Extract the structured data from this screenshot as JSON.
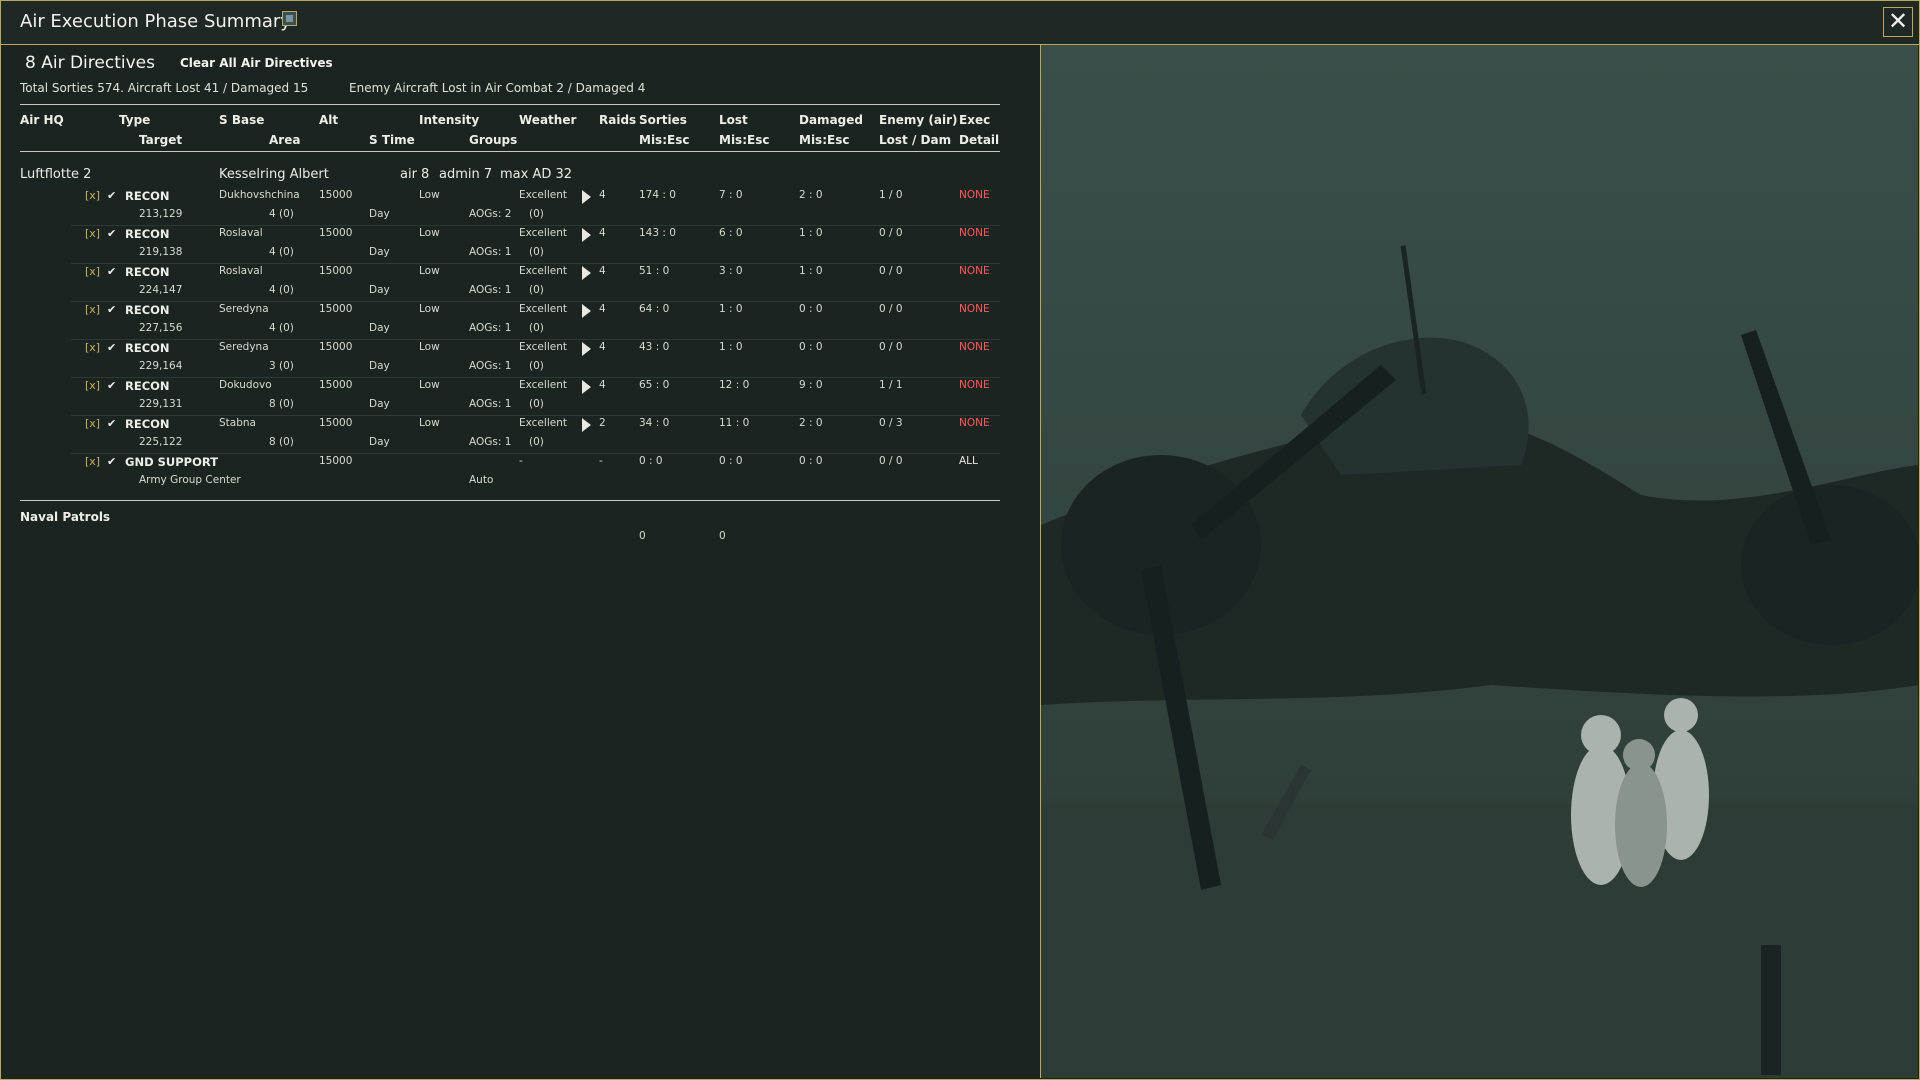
{
  "window": {
    "title": "Air Execution Phase Summary",
    "close_glyph": "✕"
  },
  "icons": {
    "title_icon": "map-icon",
    "close_icon": "close-icon",
    "raid_arrow": "play-triangle-icon",
    "check": "checkmark-icon"
  },
  "colors": {
    "frame": "#b9aa5a",
    "background": "#1b2421",
    "exec_none": "#ff5b5b"
  },
  "header_info": {
    "directives": "8 Air Directives",
    "clear_label": "Clear All Air Directives",
    "totals": "Total Sorties 574. Aircraft Lost 41 / Damaged 15",
    "enemy": "Enemy Aircraft Lost in Air Combat 2 / Damaged 4"
  },
  "columns": {
    "air_hq": "Air HQ",
    "type": "Type",
    "target": "Target",
    "s_base": "S Base",
    "area": "Area",
    "alt": "Alt",
    "s_time": "S Time",
    "intensity": "Intensity",
    "groups": "Groups",
    "weather": "Weather",
    "raids": "Raids",
    "sorties": "Sorties",
    "sorties_sub": "Mis:Esc",
    "lost": "Lost",
    "lost_sub": "Mis:Esc",
    "damaged": "Damaged",
    "damaged_sub": "Mis:Esc",
    "enemy": "Enemy (air)",
    "enemy_sub": "Lost / Dam",
    "exec": "Exec",
    "exec_sub": "Detail"
  },
  "hq": {
    "name": "Luftflotte 2",
    "commander": "Kesselring Albert",
    "air": "air 8",
    "admin": "admin 7",
    "max_ad": "max AD 32"
  },
  "directives": [
    {
      "x": "[x]",
      "check": "✔",
      "type": "RECON",
      "base": "Dukhovshchina",
      "alt": "15000",
      "intensity": "Low",
      "weather": "Excellent",
      "raids": "4",
      "sorties": "174 : 0",
      "lost": "7 : 0",
      "damaged": "2 : 0",
      "enemy": "1 / 0",
      "exec": "NONE",
      "target": "213,129",
      "area": "4 (0)",
      "time": "Day",
      "groups": "AOGs: 2",
      "groups2": "(0)"
    },
    {
      "x": "[x]",
      "check": "✔",
      "type": "RECON",
      "base": "Roslaval",
      "alt": "15000",
      "intensity": "Low",
      "weather": "Excellent",
      "raids": "4",
      "sorties": "143 : 0",
      "lost": "6 : 0",
      "damaged": "1 : 0",
      "enemy": "0 / 0",
      "exec": "NONE",
      "target": "219,138",
      "area": "4 (0)",
      "time": "Day",
      "groups": "AOGs: 1",
      "groups2": "(0)"
    },
    {
      "x": "[x]",
      "check": "✔",
      "type": "RECON",
      "base": "Roslaval",
      "alt": "15000",
      "intensity": "Low",
      "weather": "Excellent",
      "raids": "4",
      "sorties": "51 : 0",
      "lost": "3 : 0",
      "damaged": "1 : 0",
      "enemy": "0 / 0",
      "exec": "NONE",
      "target": "224,147",
      "area": "4 (0)",
      "time": "Day",
      "groups": "AOGs: 1",
      "groups2": "(0)"
    },
    {
      "x": "[x]",
      "check": "✔",
      "type": "RECON",
      "base": "Seredyna",
      "alt": "15000",
      "intensity": "Low",
      "weather": "Excellent",
      "raids": "4",
      "sorties": "64 : 0",
      "lost": "1 : 0",
      "damaged": "0 : 0",
      "enemy": "0 / 0",
      "exec": "NONE",
      "target": "227,156",
      "area": "4 (0)",
      "time": "Day",
      "groups": "AOGs: 1",
      "groups2": "(0)"
    },
    {
      "x": "[x]",
      "check": "✔",
      "type": "RECON",
      "base": "Seredyna",
      "alt": "15000",
      "intensity": "Low",
      "weather": "Excellent",
      "raids": "4",
      "sorties": "43 : 0",
      "lost": "1 : 0",
      "damaged": "0 : 0",
      "enemy": "0 / 0",
      "exec": "NONE",
      "target": "229,164",
      "area": "3 (0)",
      "time": "Day",
      "groups": "AOGs: 1",
      "groups2": "(0)"
    },
    {
      "x": "[x]",
      "check": "✔",
      "type": "RECON",
      "base": "Dokudovo",
      "alt": "15000",
      "intensity": "Low",
      "weather": "Excellent",
      "raids": "4",
      "sorties": "65 : 0",
      "lost": "12 : 0",
      "damaged": "9 : 0",
      "enemy": "1 / 1",
      "exec": "NONE",
      "target": "229,131",
      "area": "8 (0)",
      "time": "Day",
      "groups": "AOGs: 1",
      "groups2": "(0)"
    },
    {
      "x": "[x]",
      "check": "✔",
      "type": "RECON",
      "base": "Stabna",
      "alt": "15000",
      "intensity": "Low",
      "weather": "Excellent",
      "raids": "2",
      "sorties": "34 : 0",
      "lost": "11 : 0",
      "damaged": "2 : 0",
      "enemy": "0 / 3",
      "exec": "NONE",
      "target": "225,122",
      "area": "8 (0)",
      "time": "Day",
      "groups": "AOGs: 1",
      "groups2": "(0)"
    },
    {
      "x": "[x]",
      "check": "✔",
      "type": "GND SUPPORT",
      "base": "",
      "alt": "15000",
      "intensity": "",
      "weather": "-",
      "raids": "-",
      "sorties": "0 : 0",
      "lost": "0 : 0",
      "damaged": "0 : 0",
      "enemy": "0 / 0",
      "exec": "ALL",
      "target": "Army Group Center",
      "area": "",
      "time": "",
      "groups": "Auto",
      "groups2": ""
    }
  ],
  "naval": {
    "title": "Naval Patrols",
    "sorties": "0",
    "lost": "0"
  }
}
